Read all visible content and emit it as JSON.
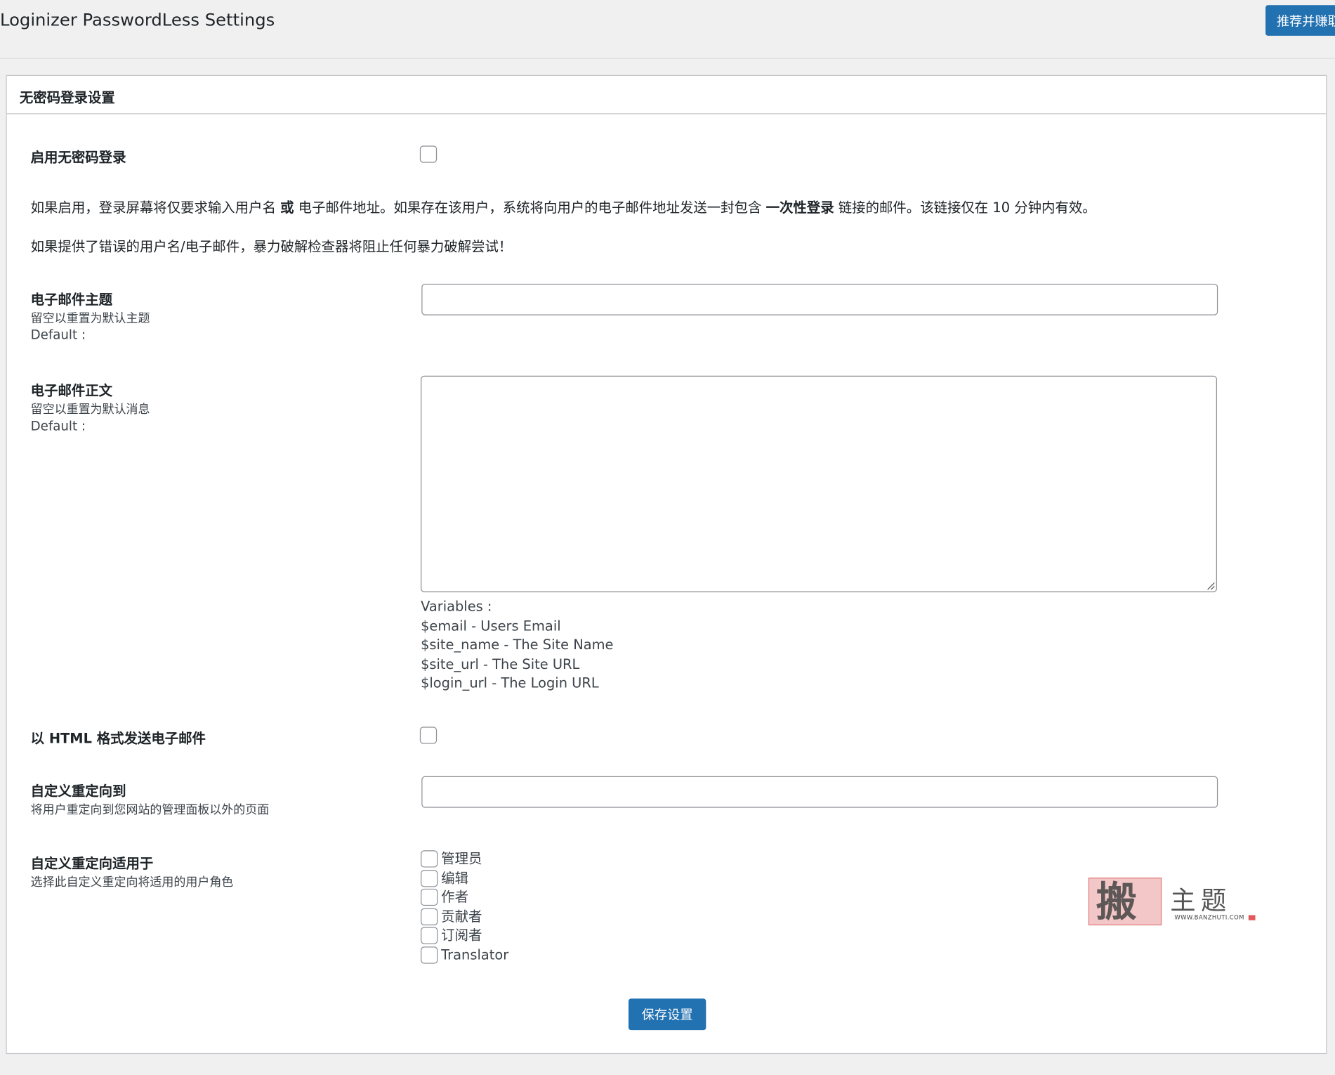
{
  "page": {
    "title": "Loginizer PasswordLess Settings",
    "promo_button": "推荐并赚取"
  },
  "panel": {
    "title": "无密码登录设置"
  },
  "enable": {
    "label": "启用无密码登录",
    "checked": false
  },
  "description": {
    "line1_part1": "如果启用，登录屏幕将仅要求输入用户名 ",
    "line1_bold1": "或",
    "line1_part2": " 电子邮件地址。如果存在该用户，系统将向用户的电子邮件地址发送一封包含 ",
    "line1_bold2": "一次性登录",
    "line1_part3": " 链接的邮件。该链接仅在 10 分钟内有效。",
    "line2": "如果提供了错误的用户名/电子邮件，暴力破解检查器将阻止任何暴力破解尝试！"
  },
  "email_subject": {
    "label": "电子邮件主题",
    "hint": "留空以重置为默认主题",
    "default_label": "Default :",
    "value": ""
  },
  "email_body": {
    "label": "电子邮件正文",
    "hint": "留空以重置为默认消息",
    "default_label": "Default :",
    "value": "",
    "variables_title": "Variables :",
    "variables": [
      "$email - Users Email",
      "$site_name - The Site Name",
      "$site_url - The Site URL",
      "$login_url - The Login URL"
    ]
  },
  "html_email": {
    "label": "以 HTML 格式发送电子邮件",
    "checked": false
  },
  "custom_redirect": {
    "label": "自定义重定向到",
    "hint": "将用户重定向到您网站的管理面板以外的页面",
    "value": ""
  },
  "redirect_roles": {
    "label": "自定义重定向适用于",
    "hint": "选择此自定义重定向将适用的用户角色",
    "roles": [
      {
        "label": "管理员",
        "checked": false
      },
      {
        "label": "编辑",
        "checked": false
      },
      {
        "label": "作者",
        "checked": false
      },
      {
        "label": "贡献者",
        "checked": false
      },
      {
        "label": "订阅者",
        "checked": false
      },
      {
        "label": "Translator",
        "checked": false
      }
    ]
  },
  "save_button": "保存设置",
  "watermark": {
    "seal": "搬",
    "text": "主题",
    "url": "WWW.BANZHUTI.COM"
  },
  "colors": {
    "primary": "#2271b1",
    "background": "#f0f0f1",
    "panel": "#ffffff",
    "border": "#c3c4c7",
    "text": "#1d2327"
  }
}
